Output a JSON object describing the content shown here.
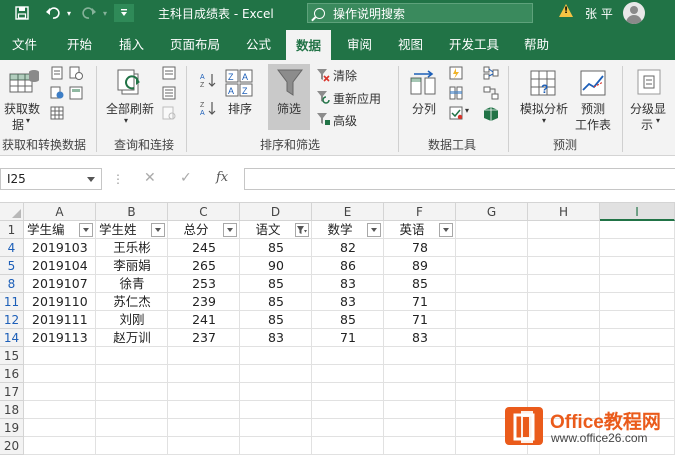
{
  "titlebar": {
    "doc_title": "主科目成绩表  -  Excel",
    "search_placeholder": "操作说明搜索",
    "user_name": "张 平"
  },
  "tabs": [
    {
      "label": "文件"
    },
    {
      "label": "开始"
    },
    {
      "label": "插入"
    },
    {
      "label": "页面布局"
    },
    {
      "label": "公式"
    },
    {
      "label": "数据"
    },
    {
      "label": "审阅"
    },
    {
      "label": "视图"
    },
    {
      "label": "开发工具"
    },
    {
      "label": "帮助"
    }
  ],
  "ribbon": {
    "get_data": "获取数",
    "get_data2": "据",
    "refresh_all": "全部刷新",
    "sort": "排序",
    "filter": "筛选",
    "clear": "清除",
    "reapply": "重新应用",
    "advanced": "高级",
    "split_columns": "分列",
    "what_if": "模拟分析",
    "forecast_sheet": "预测",
    "forecast_sheet2": "工作表",
    "outline": "分级显",
    "outline2": "示",
    "groups": {
      "get_transform": "获取和转换数据",
      "queries": "查询和连接",
      "sort_filter": "排序和筛选",
      "data_tools": "数据工具",
      "forecast": "预测"
    }
  },
  "formula_bar": {
    "name_box": "I25",
    "fx": "fx",
    "formula": ""
  },
  "sheet": {
    "columns": [
      "A",
      "B",
      "C",
      "D",
      "E",
      "F",
      "G",
      "H",
      "I"
    ],
    "selected_column": "I",
    "header_row_num": "1",
    "headers": [
      "学生编",
      "学生姓",
      "总分",
      "语文",
      "数学",
      "英语"
    ],
    "rows": [
      {
        "num": "4",
        "cells": [
          "2019103",
          "王乐彬",
          "245",
          "85",
          "82",
          "78"
        ]
      },
      {
        "num": "5",
        "cells": [
          "2019104",
          "李丽娟",
          "265",
          "90",
          "86",
          "89"
        ]
      },
      {
        "num": "8",
        "cells": [
          "2019107",
          "徐青",
          "253",
          "85",
          "83",
          "85"
        ]
      },
      {
        "num": "11",
        "cells": [
          "2019110",
          "苏仁杰",
          "239",
          "85",
          "83",
          "71"
        ]
      },
      {
        "num": "12",
        "cells": [
          "2019111",
          "刘刚",
          "241",
          "85",
          "85",
          "71"
        ]
      },
      {
        "num": "14",
        "cells": [
          "2019113",
          "赵万训",
          "237",
          "83",
          "71",
          "83"
        ]
      }
    ],
    "empty_rows": [
      "15",
      "16",
      "17",
      "18",
      "19",
      "20"
    ]
  },
  "watermark": {
    "brand": "Office教程网",
    "url": "www.office26.com"
  },
  "colors": {
    "excel_green": "#217346",
    "filtered_row_blue": "#1d5fb8",
    "watermark_orange": "#ea5b1b"
  }
}
